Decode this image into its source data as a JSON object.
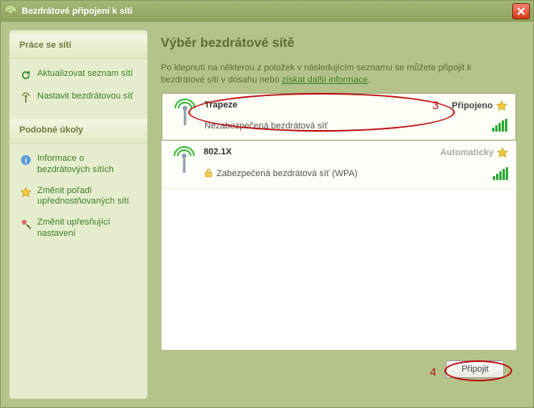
{
  "window": {
    "title": "Bezdrátové připojení k síti"
  },
  "sidebar": {
    "section1": {
      "heading": "Práce se sítí",
      "items": [
        {
          "label": "Aktualizovat seznam sítí"
        },
        {
          "label": "Nastavit bezdrátovou síť"
        }
      ]
    },
    "section2": {
      "heading": "Podobné úkoly",
      "items": [
        {
          "label": "Informace o bezdrátových sítích"
        },
        {
          "label": "Změnit pořadí upřednostňovaných sítí"
        },
        {
          "label": "Změnit upřesňující nastavení"
        }
      ]
    }
  },
  "main": {
    "title": "Výběr bezdrátové sítě",
    "desc_pre": "Po klepnutí na některou z položek v následujícím seznamu se můžete připojit k bezdrátové síti v dosahu nebo ",
    "desc_link": "získat další informace"
  },
  "networks": [
    {
      "name": "Trapeze",
      "security": "Nezabezpečená bezdrátová síť",
      "status": "Připojeno",
      "status_style": "normal",
      "secured": false
    },
    {
      "name": "802.1X",
      "security": "Zabezpečená bezdrátová síť (WPA)",
      "status": "Automaticky",
      "status_style": "auto",
      "secured": true
    }
  ],
  "footer": {
    "connect": "Připojit"
  },
  "annotations": {
    "marker3": "3",
    "marker4": "4"
  }
}
